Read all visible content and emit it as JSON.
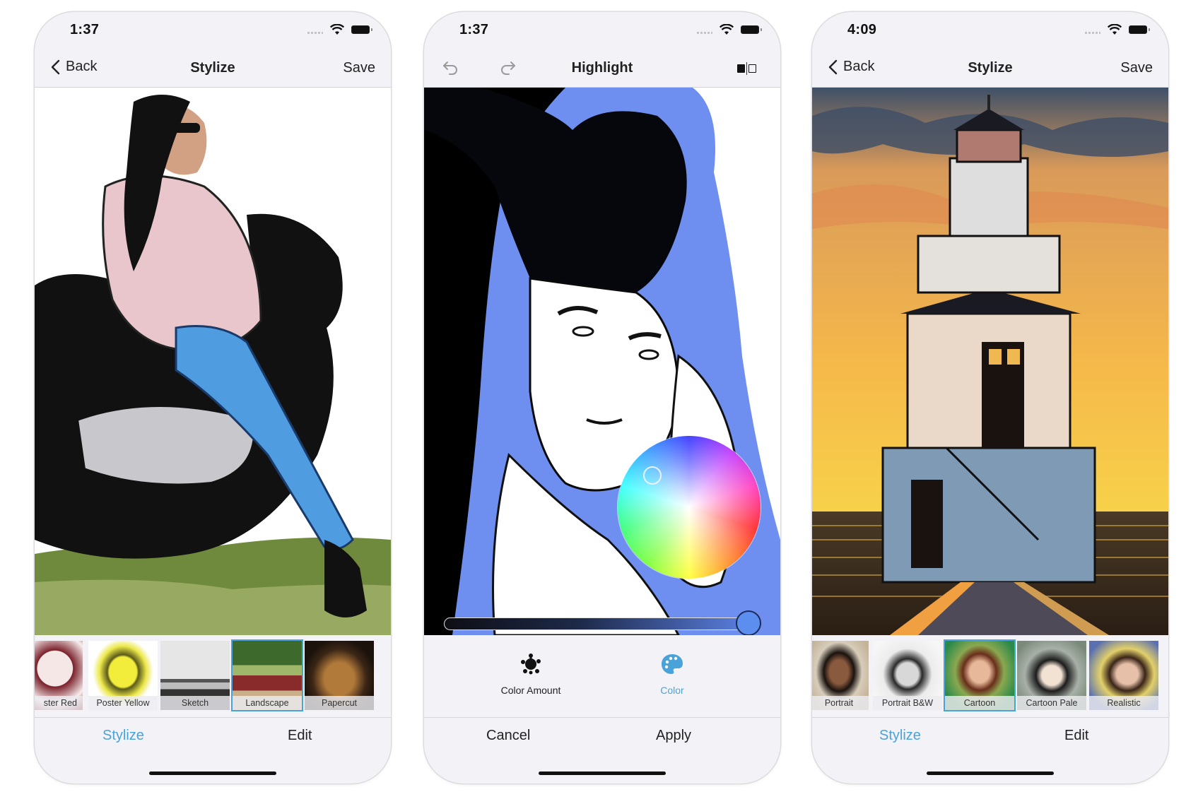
{
  "accent_color": "#4aa3d8",
  "phones": [
    {
      "status": {
        "time": "1:37"
      },
      "nav": {
        "back_label": "Back",
        "title": "Stylize",
        "action_label": "Save"
      },
      "thumbnails": [
        {
          "label": "ster Red",
          "selected": false
        },
        {
          "label": "Poster Yellow",
          "selected": false
        },
        {
          "label": "Sketch",
          "selected": false
        },
        {
          "label": "Landscape",
          "selected": true
        },
        {
          "label": "Papercut",
          "selected": false
        }
      ],
      "tabs": [
        {
          "label": "Stylize",
          "active": true
        },
        {
          "label": "Edit",
          "active": false
        }
      ]
    },
    {
      "status": {
        "time": "1:37"
      },
      "nav": {
        "title": "Highlight",
        "undo_icon": "undo-icon",
        "redo_icon": "redo-icon",
        "compare_icon": "split-compare-icon"
      },
      "highlight_color": "#6e8ff0",
      "slider": {
        "value_percent": 100
      },
      "color_picker": {
        "selected_hue": "blue",
        "visible": true
      },
      "tools": [
        {
          "label": "Color Amount",
          "icon": "splat-icon",
          "active": false
        },
        {
          "label": "Color",
          "icon": "palette-icon",
          "active": true
        }
      ],
      "actions": {
        "cancel_label": "Cancel",
        "apply_label": "Apply"
      }
    },
    {
      "status": {
        "time": "4:09"
      },
      "nav": {
        "back_label": "Back",
        "title": "Stylize",
        "action_label": "Save"
      },
      "thumbnails": [
        {
          "label": "Portrait",
          "selected": false
        },
        {
          "label": "Portrait B&W",
          "selected": false
        },
        {
          "label": "Cartoon",
          "selected": true
        },
        {
          "label": "Cartoon Pale",
          "selected": false
        },
        {
          "label": "Realistic",
          "selected": false
        }
      ],
      "tabs": [
        {
          "label": "Stylize",
          "active": true
        },
        {
          "label": "Edit",
          "active": false
        }
      ]
    }
  ]
}
